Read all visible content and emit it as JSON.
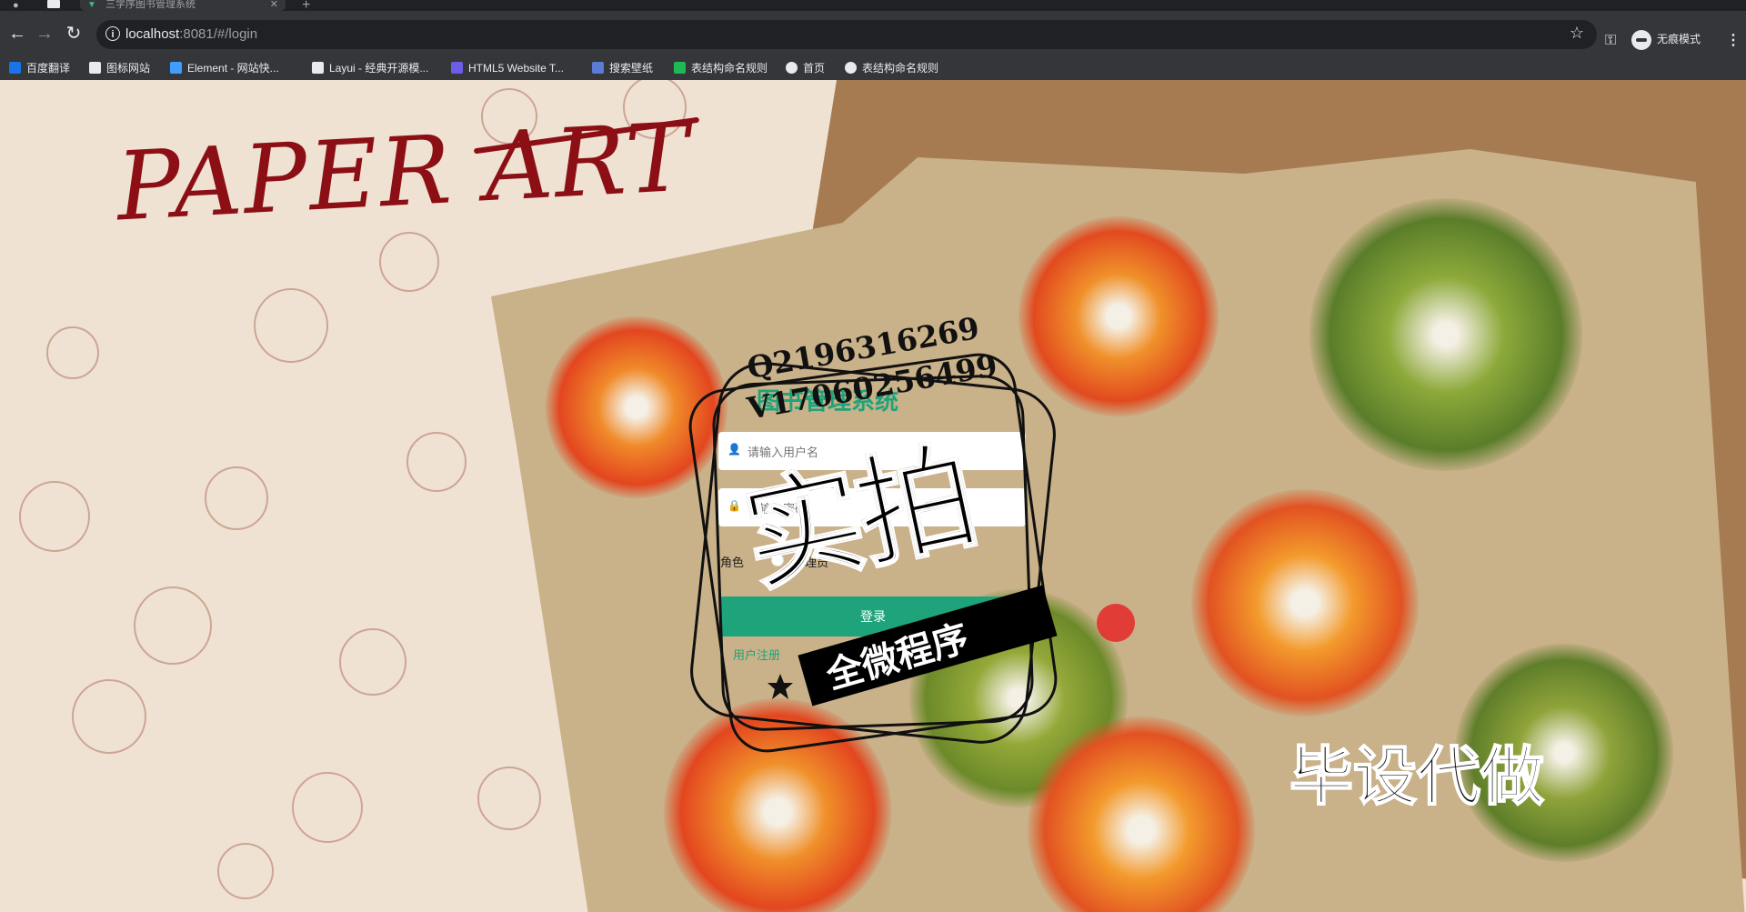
{
  "browser": {
    "tab_title": "三学序图书管理系统",
    "url_host": "localhost",
    "url_rest": ":8081/#/login",
    "incognito_label": "无痕模式"
  },
  "bookmarks": [
    {
      "label": "百度翻译",
      "color": "#1a73e8"
    },
    {
      "label": "图标网站",
      "color": "#e8eaed"
    },
    {
      "label": "Element - 网站快...",
      "color": "#409eff"
    },
    {
      "label": "Layui - 经典开源模...",
      "color": "#e8eaed"
    },
    {
      "label": "HTML5 Website T...",
      "color": "#6c5ce7"
    },
    {
      "label": "搜索壁纸",
      "color": "#5b7bd5"
    },
    {
      "label": "表结构命名规则",
      "color": "#1db954"
    },
    {
      "label": "首页",
      "color": "#e8eaed"
    },
    {
      "label": "表结构命名规则",
      "color": "#e8eaed"
    }
  ],
  "page": {
    "brand": "PAPER ART",
    "title": "图书管理系统",
    "username_placeholder": "请输入用户名",
    "password_placeholder": "请输入密码",
    "role_label": "角色",
    "role_option": "管理员",
    "login_button": "登录",
    "register_link": "用户注册"
  },
  "watermark": {
    "line1": "Q2196316269",
    "line2": "V17060256499",
    "big": "实拍",
    "ribbon": "全微程序",
    "bottom": "毕设代做"
  },
  "colors": {
    "accent": "#1fa37a",
    "brand": "#8b0f14"
  }
}
